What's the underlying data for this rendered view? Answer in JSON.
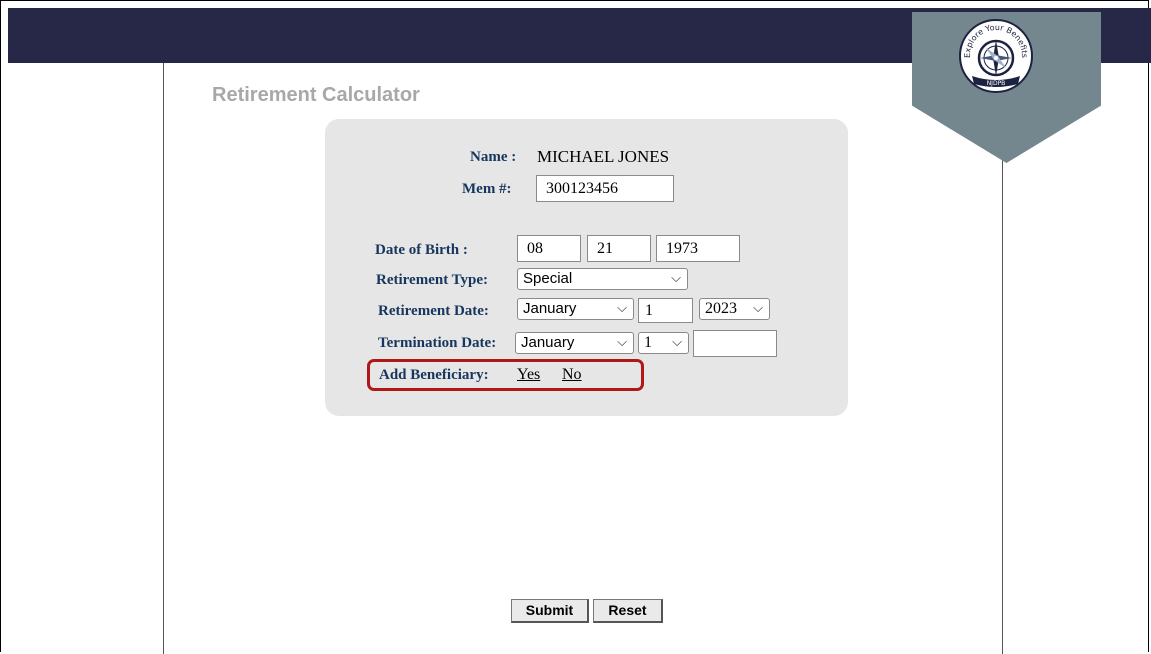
{
  "app": {
    "title": "Retirement Calculator"
  },
  "member": {
    "name_label": "Name :",
    "name_value": "MICHAEL JONES",
    "mem_label": "Mem #:",
    "mem_value": "300123456"
  },
  "dob": {
    "label": "Date of Birth :",
    "month": "08",
    "day": "21",
    "year": "1973"
  },
  "retirement_type": {
    "label": "Retirement Type:",
    "selected": "Special"
  },
  "retirement_date": {
    "label": "Retirement Date:",
    "month": "January",
    "day": "1",
    "year": "2023"
  },
  "termination_date": {
    "label": "Termination Date:",
    "month": "January",
    "day": "1",
    "year": ""
  },
  "beneficiary": {
    "label": "Add Beneficiary:",
    "yes": "Yes",
    "no": "No"
  },
  "buttons": {
    "submit": "Submit",
    "reset": "Reset"
  },
  "logo": {
    "top_text": "Explore Your Benefits",
    "bottom_text": "NJDPB",
    "icon": "compass-icon"
  },
  "colors": {
    "header": "#272747",
    "label": "#17365d",
    "highlight": "#b01818",
    "pennant": "#74878e"
  }
}
